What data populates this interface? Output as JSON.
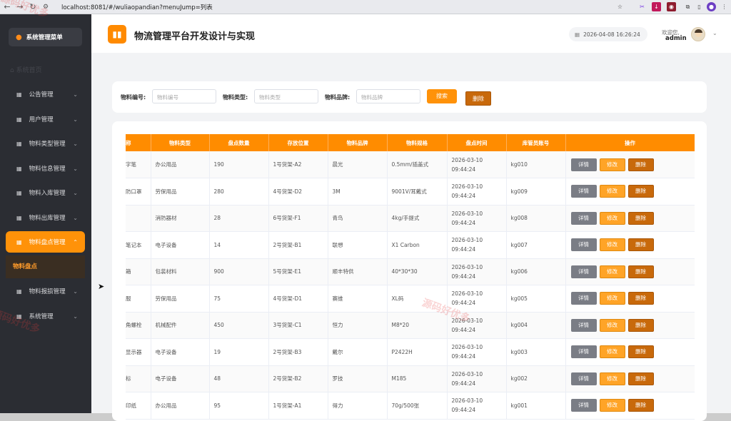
{
  "browser": {
    "url": "localhost:8081/#/wuliaopandian?menuJump=列表",
    "watermark": "源码好优多"
  },
  "sidebar": {
    "title": "系统管理菜单",
    "home": "系统首页",
    "items": [
      {
        "label": "公告管理",
        "expanded": false
      },
      {
        "label": "用户管理",
        "expanded": false
      },
      {
        "label": "物料类型管理",
        "expanded": false
      },
      {
        "label": "物料信息管理",
        "expanded": false
      },
      {
        "label": "物料入库管理",
        "expanded": false
      },
      {
        "label": "物料出库管理",
        "expanded": false
      },
      {
        "label": "物料盘点管理",
        "expanded": true
      },
      {
        "label": "物料报损管理",
        "expanded": false
      },
      {
        "label": "系统管理",
        "expanded": false
      }
    ],
    "submenu_label": "物料盘点"
  },
  "header": {
    "title": "物流管理平台开发设计与实现",
    "datetime": "2026-04-08 16:26:24",
    "welcome": "欢迎您,",
    "user": "admin"
  },
  "search": {
    "code_label": "物料编号:",
    "code_placeholder": "物料编号",
    "type_label": "物料类型:",
    "type_placeholder": "物料类型",
    "brand_label": "物料品牌:",
    "brand_placeholder": "物料品牌",
    "search_button": "搜索",
    "delete_button": "删除"
  },
  "table": {
    "headers": [
      "称",
      "物料类型",
      "盘点数量",
      "存放位置",
      "物料品牌",
      "物料规格",
      "盘点时间",
      "库管员账号",
      "操作"
    ],
    "buttons": {
      "detail": "详情",
      "edit": "修改",
      "delete": "删除"
    },
    "rows": [
      {
        "name": "字笔",
        "type": "办公用品",
        "qty": "190",
        "loc": "1号货架-A2",
        "brand": "晨光",
        "spec": "0.5mm/插盖式",
        "date": "2026-03-10",
        "time": "09:44:24",
        "acct": "kg010"
      },
      {
        "name": "防口罩",
        "type": "劳保用品",
        "qty": "280",
        "loc": "4号货架-D2",
        "brand": "3M",
        "spec": "9001V/耳戴式",
        "date": "2026-03-10",
        "time": "09:44:24",
        "acct": "kg009"
      },
      {
        "name": "",
        "type": "消防器材",
        "qty": "28",
        "loc": "6号货架-F1",
        "brand": "青鸟",
        "spec": "4kg/手提式",
        "date": "2026-03-10",
        "time": "09:44:24",
        "acct": "kg008"
      },
      {
        "name": "笔记本",
        "type": "电子设备",
        "qty": "14",
        "loc": "2号货架-B1",
        "brand": "联想",
        "spec": "X1 Carbon",
        "date": "2026-03-10",
        "time": "09:44:24",
        "acct": "kg007"
      },
      {
        "name": "箱",
        "type": "包装材料",
        "qty": "900",
        "loc": "5号货架-E1",
        "brand": "顺丰特供",
        "spec": "40*30*30",
        "date": "2026-03-10",
        "time": "09:44:24",
        "acct": "kg006"
      },
      {
        "name": "服",
        "type": "劳保用品",
        "qty": "75",
        "loc": "4号货架-D1",
        "brand": "赛维",
        "spec": "XL码",
        "date": "2026-03-10",
        "time": "09:44:24",
        "acct": "kg005"
      },
      {
        "name": "角螺栓",
        "type": "机械配件",
        "qty": "450",
        "loc": "3号货架-C1",
        "brand": "恒力",
        "spec": "M8*20",
        "date": "2026-03-10",
        "time": "09:44:24",
        "acct": "kg004"
      },
      {
        "name": "显示器",
        "type": "电子设备",
        "qty": "19",
        "loc": "2号货架-B3",
        "brand": "戴尔",
        "spec": "P2422H",
        "date": "2026-03-10",
        "time": "09:44:24",
        "acct": "kg003"
      },
      {
        "name": "标",
        "type": "电子设备",
        "qty": "48",
        "loc": "2号货架-B2",
        "brand": "罗技",
        "spec": "M185",
        "date": "2026-03-10",
        "time": "09:44:24",
        "acct": "kg002"
      },
      {
        "name": "印纸",
        "type": "办公用品",
        "qty": "95",
        "loc": "1号货架-A1",
        "brand": "得力",
        "spec": "70g/500张",
        "date": "2026-03-10",
        "time": "09:44:24",
        "acct": "kg001"
      }
    ]
  },
  "colors": {
    "accent": "#ff9209",
    "header_orange": "#ff8c00",
    "sidebar_bg": "#2b2d33",
    "delete_brown": "#c8690b"
  }
}
